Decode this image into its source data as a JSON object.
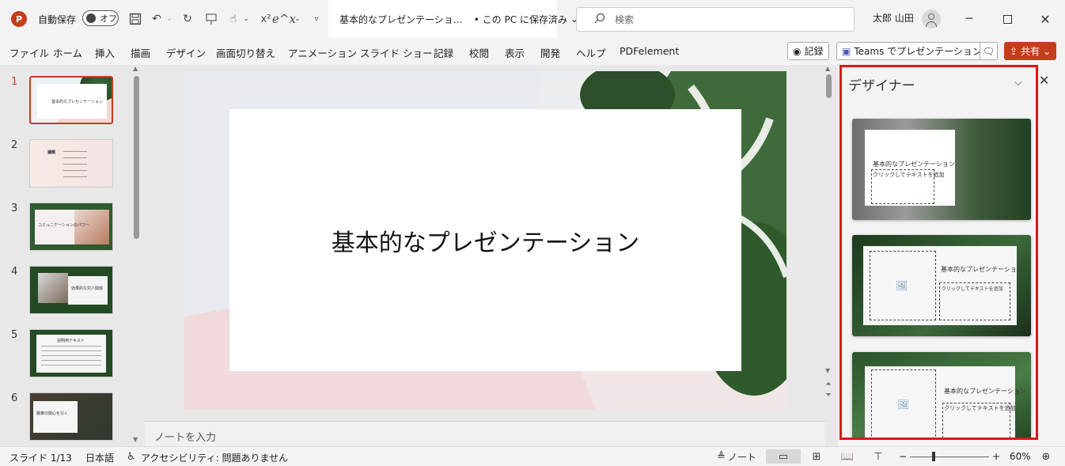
{
  "titlebar": {
    "app_logo": "P",
    "autosave_label": "自動保存",
    "autosave_state": "オフ",
    "doc_title": "基本的なプレゼンテーショ…",
    "save_status": "• この PC に保存済み",
    "search_placeholder": "検索",
    "user_name": "太郎 山田",
    "superscript_label": "x²",
    "equation_label": "e^x"
  },
  "ribbon": {
    "tabs": [
      "ファイル",
      "ホーム",
      "挿入",
      "描画",
      "デザイン",
      "画面切り替え",
      "アニメーション",
      "スライド ショー",
      "記録",
      "校閲",
      "表示",
      "開発",
      "ヘルプ",
      "PDFelement"
    ],
    "record_button": "記録",
    "teams_button": "Teams でプレゼンテーション",
    "share_button": "共有"
  },
  "thumbnails": {
    "slides": [
      {
        "number": "1",
        "caption": "基本的なプレゼンテーション"
      },
      {
        "number": "2",
        "caption": "議題"
      },
      {
        "number": "3",
        "caption": "コミュニケーションのパワー"
      },
      {
        "number": "4",
        "caption": "効果的な対人関係"
      },
      {
        "number": "5",
        "caption": "説明用テキスト"
      },
      {
        "number": "6",
        "caption": "聴衆の関心を引く"
      }
    ]
  },
  "slide": {
    "title": "基本的なプレゼンテーション"
  },
  "notes": {
    "placeholder": "ノートを入力"
  },
  "designer": {
    "title": "デザイナー",
    "cards": [
      {
        "title": "基本的なプレゼンテーション",
        "subtitle": "クリックしてテキストを追加"
      },
      {
        "title": "基本的なプレゼンテーション",
        "subtitle": "クリックしてテキストを追加"
      },
      {
        "title": "基本的なプレゼンテーション",
        "subtitle": "クリックしてテキストを追加"
      }
    ]
  },
  "statusbar": {
    "slide_info": "スライド 1/13",
    "language": "日本語",
    "accessibility": "アクセシビリティ: 問題ありません",
    "notes_button": "ノート",
    "zoom_minus": "−",
    "zoom_plus": "+",
    "zoom_level": "60%"
  },
  "colors": {
    "accent": "#c43e1c",
    "designer_highlight": "#e1161b"
  }
}
